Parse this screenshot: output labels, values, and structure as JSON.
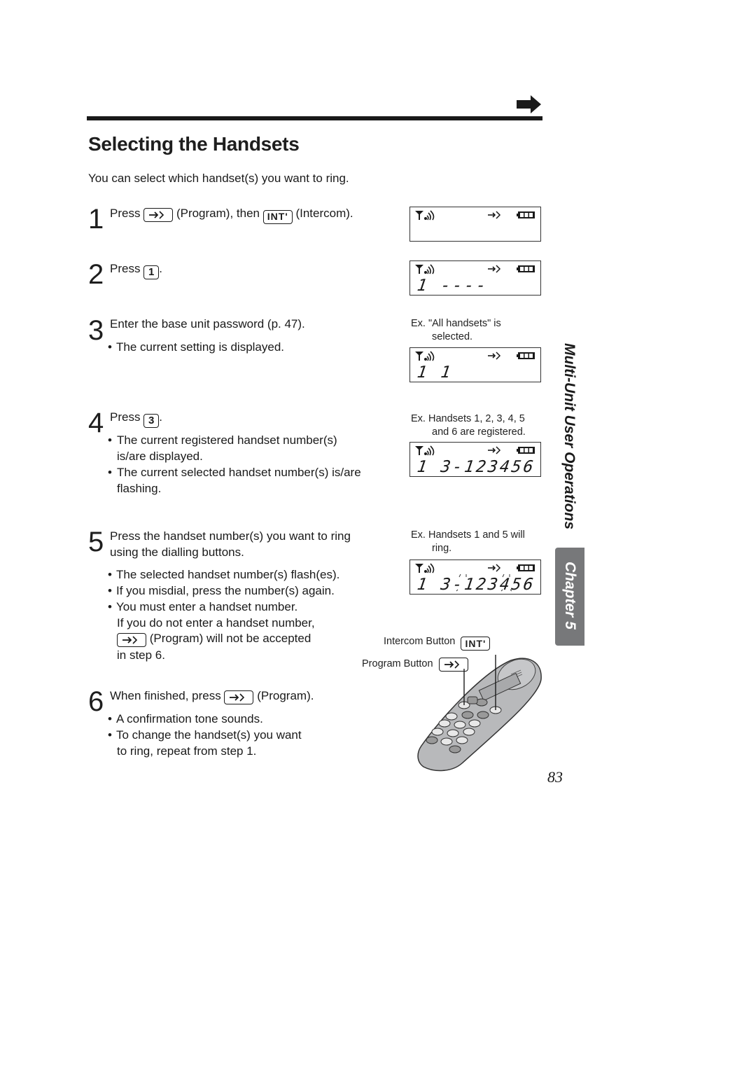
{
  "header": {
    "next_page_icon": "right-arrow-icon"
  },
  "title": "Selecting the Handsets",
  "intro": "You can select which handset(s) you want to ring.",
  "keys": {
    "program": "→◇",
    "intercom": "INT'",
    "one": "1",
    "three": "3"
  },
  "steps": [
    {
      "num": "1",
      "parts": {
        "before": "Press",
        "mid": "(Program), then",
        "after": "(Intercom)."
      }
    },
    {
      "num": "2",
      "parts": {
        "before": "Press",
        "after": "."
      }
    },
    {
      "num": "3",
      "text": "Enter the base unit password (p. 47).",
      "bullets": [
        "The current setting is displayed."
      ]
    },
    {
      "num": "4",
      "parts": {
        "before": "Press",
        "after": "."
      },
      "bullets": [
        "The current registered handset number(s) is/are displayed.",
        "The current selected handset number(s) is/are flashing."
      ]
    },
    {
      "num": "5",
      "text_line1": "Press the handset number(s) you want to ring",
      "text_line2": "using the dialling buttons.",
      "bullets": [
        "The selected handset number(s) flash(es).",
        "If you misdial, press the number(s) again.",
        "You must enter a handset number."
      ],
      "note_line1": "If you do not enter a handset number,",
      "note_line2": "(Program) will not be accepted",
      "note_line3": "in step 6."
    },
    {
      "num": "6",
      "parts": {
        "before": "When finished, press",
        "after": "(Program)."
      },
      "bullets": [
        "A confirmation tone sounds.",
        "To change the handset(s) you want"
      ],
      "bullet2_cont": "to ring, repeat from step 1."
    }
  ],
  "displays": [
    {
      "digits": ""
    },
    {
      "digits": "1 ----"
    },
    {
      "caption1": "Ex.  \"All handsets\" is",
      "caption2": "selected.",
      "digits": "1  1"
    },
    {
      "caption1": "Ex.  Handsets 1, 2, 3, 4, 5",
      "caption2": "and 6 are registered.",
      "digits": "1 3-123456"
    },
    {
      "caption1": "Ex. Handsets 1 and 5 will",
      "caption2": "ring.",
      "digits": "1 3-123456",
      "flashing": [
        "1",
        "5"
      ]
    }
  ],
  "display_icons": [
    "antenna-signal-icon",
    "program-icon",
    "battery-icon"
  ],
  "handset_labels": {
    "intercom": "Intercom Button",
    "program": "Program Button"
  },
  "sidebar": {
    "section": "Multi-Unit User Operations",
    "chapter": "Chapter 5"
  },
  "page_number": "83"
}
